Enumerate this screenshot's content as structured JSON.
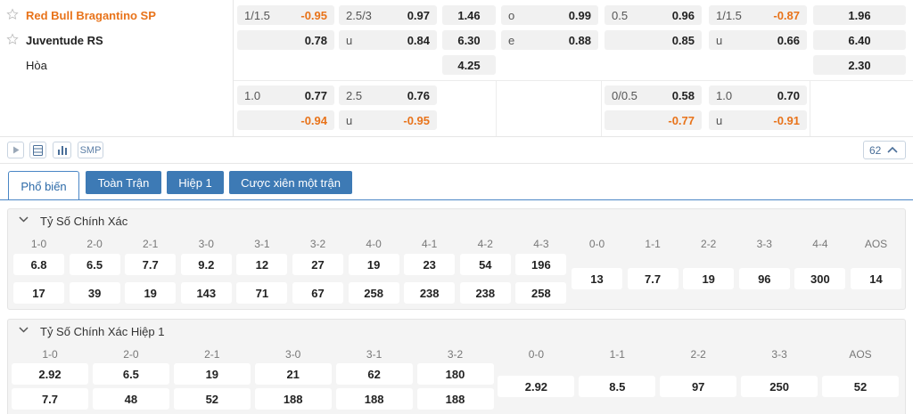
{
  "match": {
    "home_team": "Red Bull Bragantino SP",
    "away_team": "Juventude RS",
    "draw_label": "Hòa",
    "row1": {
      "ah_line": "1/1.5",
      "ah_home": "-0.95",
      "ou_line": "2.5/3",
      "ou_over": "0.97",
      "x12_home": "1.46",
      "oe_o_label": "o",
      "oe_o": "0.99",
      "h1_ah_line": "0.5",
      "h1_ah_home": "0.96",
      "h1_ou_line": "1/1.5",
      "h1_ou_over": "-0.87",
      "h1_x12_home": "1.96"
    },
    "row2": {
      "ah_away": "0.78",
      "ou_u_label": "u",
      "ou_under": "0.84",
      "x12_away": "6.30",
      "oe_e_label": "e",
      "oe_e": "0.88",
      "h1_ah_away": "0.85",
      "h1_ou_u_label": "u",
      "h1_ou_under": "0.66",
      "h1_x12_away": "6.40"
    },
    "row3": {
      "x12_draw": "4.25",
      "h1_x12_draw": "2.30"
    },
    "alt1": {
      "ah_line": "1.0",
      "ah_home": "0.77",
      "ou_line": "2.5",
      "ou_over": "0.76",
      "h1_ah_line": "0/0.5",
      "h1_ah_home": "0.58",
      "h1_ou_line": "1.0",
      "h1_ou_over": "0.70"
    },
    "alt2": {
      "ah_away": "-0.94",
      "ou_u_label": "u",
      "ou_under": "-0.95",
      "h1_ah_away": "-0.77",
      "h1_ou_u_label": "u",
      "h1_ou_under": "-0.91"
    }
  },
  "toolbar": {
    "smp_label": "SMP",
    "market_count": "62"
  },
  "tabs": [
    "Phổ biến",
    "Toàn Trận",
    "Hiệp 1",
    "Cược xiên một trận"
  ],
  "correct_score": {
    "title": "Tỷ Số Chính Xác",
    "home_labels": [
      "1-0",
      "2-0",
      "2-1",
      "3-0",
      "3-1",
      "3-2",
      "4-0",
      "4-1",
      "4-2",
      "4-3"
    ],
    "home_odds": [
      "6.8",
      "6.5",
      "7.7",
      "9.2",
      "12",
      "27",
      "19",
      "23",
      "54",
      "196"
    ],
    "away_odds": [
      "17",
      "39",
      "19",
      "143",
      "71",
      "67",
      "258",
      "238",
      "238",
      "258"
    ],
    "draw_labels": [
      "0-0",
      "1-1",
      "2-2",
      "3-3",
      "4-4",
      "AOS"
    ],
    "draw_odds": [
      "13",
      "7.7",
      "19",
      "96",
      "300",
      "14"
    ]
  },
  "correct_score_h1": {
    "title": "Tỷ Số Chính Xác Hiệp 1",
    "home_labels": [
      "1-0",
      "2-0",
      "2-1",
      "3-0",
      "3-1",
      "3-2"
    ],
    "home_odds": [
      "2.92",
      "6.5",
      "19",
      "21",
      "62",
      "180"
    ],
    "away_odds": [
      "7.7",
      "48",
      "52",
      "188",
      "188",
      "188"
    ],
    "draw_labels": [
      "0-0",
      "1-1",
      "2-2",
      "3-3",
      "AOS"
    ],
    "draw_odds": [
      "2.92",
      "8.5",
      "97",
      "250",
      "52"
    ]
  },
  "colors": {
    "accent_orange": "#e8731a",
    "tab_blue": "#3d7ab5",
    "panel_bg": "#f4f4f4"
  }
}
